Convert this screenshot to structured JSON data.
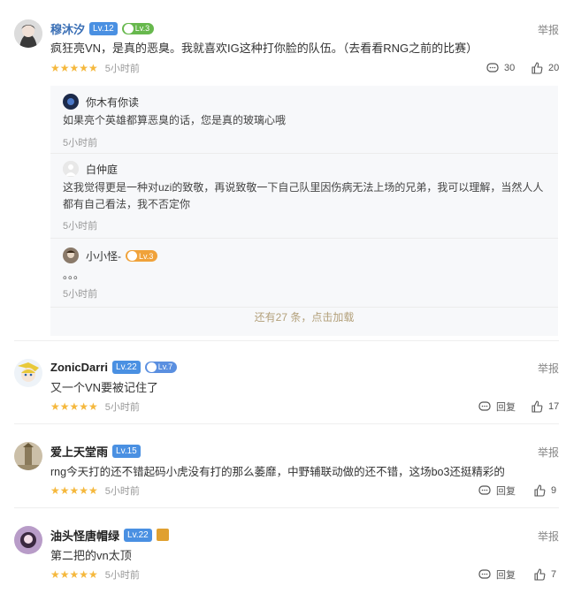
{
  "report_label": "举报",
  "comments": [
    {
      "username": "穆沐汐",
      "level": "Lv.12",
      "medal": "Lv.3",
      "text": "疯狂亮VN，是真的恶臭。我就喜欢IG这种打你脸的队伍。（去看看RNG之前的比赛）",
      "stars": "★★★★★",
      "time": "5小时前",
      "comment_count": "30",
      "like_count": "20"
    },
    {
      "username": "ZonicDarri",
      "level": "Lv.22",
      "medal": "Lv.7",
      "text": "又一个VN要被记住了",
      "stars": "★★★★★",
      "time": "5小时前",
      "reply_label": "回复",
      "like_count": "17"
    },
    {
      "username": "爱上天堂雨",
      "level": "Lv.15",
      "text": "rng今天打的还不错起码小虎没有打的那么萎靡，中野辅联动做的还不错，这场bo3还挺精彩的",
      "stars": "★★★★★",
      "time": "5小时前",
      "reply_label": "回复",
      "like_count": "9"
    },
    {
      "username": "油头怪唐帽绿",
      "level": "Lv.22",
      "text": "第二把的vn太顶",
      "stars": "★★★★★",
      "time": "5小时前",
      "reply_label": "回复",
      "like_count": "7"
    }
  ],
  "replies": [
    {
      "username": "你木有你读",
      "text": "如果亮个英雄都算恶臭的话，您是真的玻璃心哦",
      "time": "5小时前"
    },
    {
      "username": "白仲庭",
      "text": "这我觉得更是一种对uzi的致敬，再说致敬一下自己队里因伤病无法上场的兄弟，我可以理解，当然人人都有自己看法，我不否定你",
      "time": "5小时前"
    },
    {
      "username": "小小怪-",
      "medal": "Lv.3",
      "text": "。。。",
      "time": "5小时前"
    }
  ],
  "more_replies": "还有27 条，点击加载",
  "colors": {
    "level_badge": "#4a90e2",
    "star": "#f5b83d",
    "more_text": "#b3a07a"
  }
}
